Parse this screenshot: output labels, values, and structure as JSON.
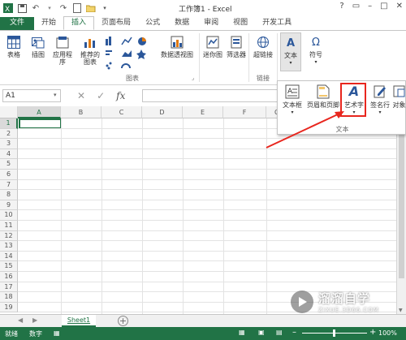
{
  "window": {
    "title": "工作簿1 - Excel"
  },
  "qat": [
    "save-icon",
    "undo-icon",
    "redo-icon",
    "new-icon",
    "open-icon",
    "customize-icon"
  ],
  "tabs": [
    {
      "label": "文件",
      "kind": "file"
    },
    {
      "label": "开始"
    },
    {
      "label": "插入",
      "active": true
    },
    {
      "label": "页面布局"
    },
    {
      "label": "公式"
    },
    {
      "label": "数据"
    },
    {
      "label": "审阅"
    },
    {
      "label": "视图"
    },
    {
      "label": "开发工具"
    }
  ],
  "ribbon": {
    "table": "表格",
    "illustrations": "插图",
    "apps": "应用程\n序",
    "recommended_charts": "推荐的\n图表",
    "pivot_chart": "数据透视图",
    "sparkline": "迷你图",
    "filter": "筛选器",
    "hyperlink": "超链接",
    "text": "文本",
    "symbol": "符号",
    "group_charts": "图表",
    "group_links": "链接"
  },
  "formula_bar": {
    "name_box": "A1",
    "value": ""
  },
  "grid": {
    "columns": [
      "A",
      "B",
      "C",
      "D",
      "E",
      "F",
      "G"
    ],
    "rows": [
      "1",
      "2",
      "3",
      "4",
      "5",
      "6",
      "7",
      "8",
      "9",
      "10",
      "11",
      "12",
      "13",
      "14",
      "15",
      "16",
      "17",
      "18",
      "19"
    ]
  },
  "sheets": {
    "active": "Sheet1"
  },
  "status": {
    "ready": "就绪",
    "mode": "数字",
    "zoom": "100%"
  },
  "dropdown": {
    "textbox": "文本框",
    "header_footer": "页眉和页脚",
    "wordart": "艺术字",
    "signature": "签名行",
    "object": "对象",
    "group": "文本"
  },
  "watermark": {
    "brand": "溜溜自学",
    "url": "ZIXUE.3D66.COM"
  },
  "colors": {
    "excel_green": "#217346",
    "highlight": "#e8261e"
  }
}
